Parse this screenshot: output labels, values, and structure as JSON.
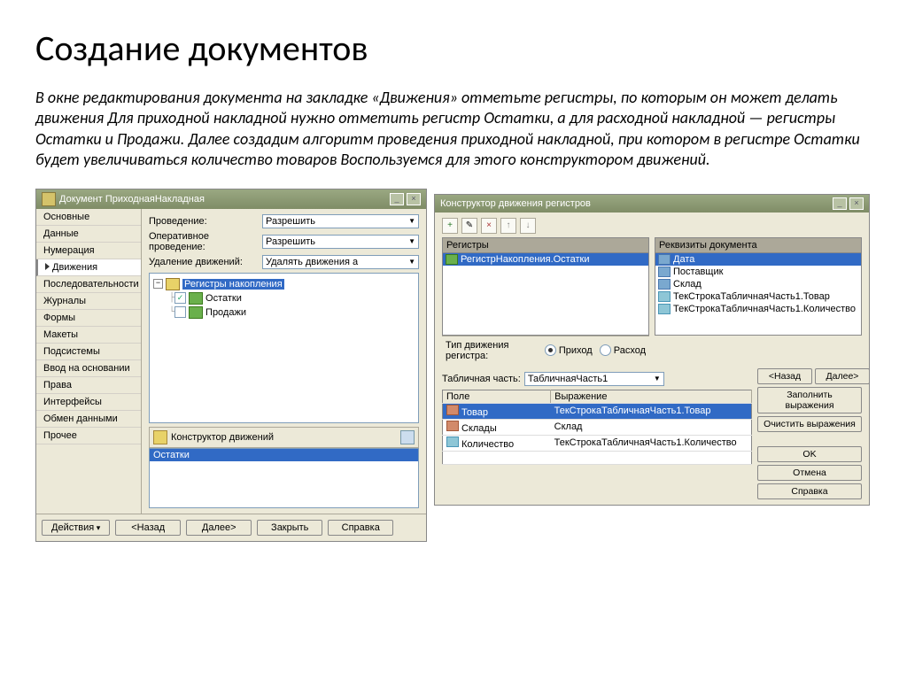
{
  "heading": "Создание документов",
  "intro": "В окне редактирования документа на закладке «Движения» отметьте регистры, по которым он может делать движения Для приходной накладной нужно отметить регистр Остатки, а для расходной накладной — регистры Остатки и Продажи. Далее создадим алгоритм проведения приходной накладной, при котором в регистре Остатки будет увеличиваться количество товаров Воспользуемся для этого конструктором движений.",
  "win1": {
    "title": "Документ ПриходнаяНакладная",
    "tabs": [
      "Основные",
      "Данные",
      "Нумерация",
      "Движения",
      "Последовательности",
      "Журналы",
      "Формы",
      "Макеты",
      "Подсистемы",
      "Ввод на основании",
      "Права",
      "Интерфейсы",
      "Обмен данными",
      "Прочее"
    ],
    "active_tab": "Движения",
    "form": {
      "label_provedenie": "Проведение:",
      "val_provedenie": "Разрешить",
      "label_oper": "Оперативное проведение:",
      "val_oper": "Разрешить",
      "label_del": "Удаление движений:",
      "val_del": "Удалять движения а"
    },
    "tree": {
      "root": "Регистры накопления",
      "child1": "Остатки",
      "child1_checked": true,
      "child2": "Продажи",
      "child2_checked": false
    },
    "constructor_label": "Конструктор движений",
    "list_selected": "Остатки",
    "buttons": {
      "actions": "Действия",
      "back": "<Назад",
      "next": "Далее>",
      "close": "Закрыть",
      "help": "Справка"
    }
  },
  "win2": {
    "title": "Конструктор движения регистров",
    "registers_header": "Регистры",
    "register_item": "РегистрНакопления.Остатки",
    "reqs_header": "Реквизиты документа",
    "reqs": [
      "Дата",
      "Поставщик",
      "Склад",
      "ТекСтрокаТабличнаяЧасть1.Товар",
      "ТекСтрокаТабличнаяЧасть1.Количество"
    ],
    "radio_label": "Тип движения регистра:",
    "radio_prihod": "Приход",
    "radio_rashod": "Расход",
    "tabpart_label": "Табличная часть:",
    "tabpart_val": "ТабличнаяЧасть1",
    "buttons": {
      "back": "<Назад",
      "next": "Далее>",
      "fill": "Заполнить выражения",
      "clear": "Очистить выражения",
      "ok": "OK",
      "cancel": "Отмена",
      "help": "Справка"
    },
    "table": {
      "h1": "Поле",
      "h2": "Выражение",
      "rows": [
        {
          "f": "Товар",
          "e": "ТекСтрокаТабличнаяЧасть1.Товар",
          "sel": true,
          "icn": "red"
        },
        {
          "f": "Склады",
          "e": "Склад",
          "sel": false,
          "icn": "red"
        },
        {
          "f": "Количество",
          "e": "ТекСтрокаТабличнаяЧасть1.Количество",
          "sel": false,
          "icn": "cyan"
        }
      ]
    }
  }
}
